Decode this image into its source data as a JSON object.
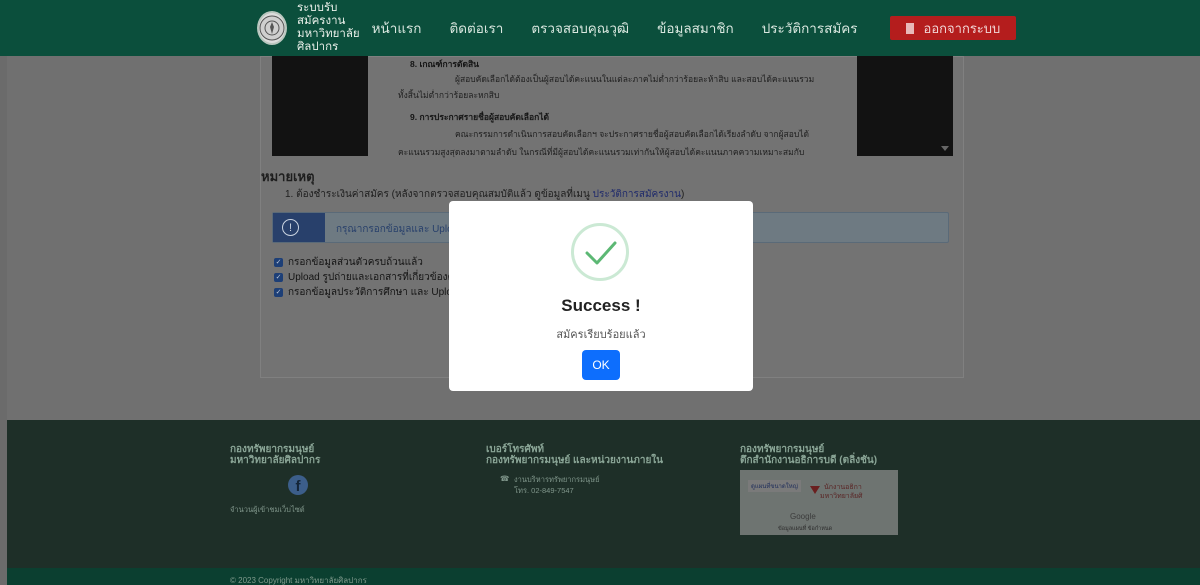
{
  "navbar": {
    "brand_line1": "ระบบรับสมัครงาน",
    "brand_line2": "มหาวิทยาลัยศิลปากร",
    "links": [
      "หน้าแรก",
      "ติดต่อเรา",
      "ตรวจสอบคุณวุฒิ",
      "ข้อมูลสมาชิก",
      "ประวัติการสมัคร"
    ],
    "logout_label": "ออกจากระบบ"
  },
  "document": {
    "line_partial": "8. เกณฑ์การตัดสิน",
    "line1": "ผู้สอบคัดเลือกได้ต้องเป็นผู้สอบได้คะแนนในแต่ละภาคไม่ต่ำกว่าร้อยละห้าสิบ และสอบได้คะแนนรวม",
    "line2": "ทั้งสิ้นไม่ต่ำกว่าร้อยละหกสิบ",
    "section9_title": "9.  การประกาศรายชื่อผู้สอบคัดเลือกได้",
    "line3": "คณะกรรมการดำเนินการสอบคัดเลือกฯ จะประกาศรายชื่อผู้สอบคัดเลือกได้เรียงลำดับ จากผู้สอบได้",
    "line4": "คะแนนรวมสูงสุดลงมาตามลำดับ ในกรณีที่มีผู้สอบได้คะแนนรวมเท่ากันให้ผู้สอบได้คะแนนภาคความเหมาะสมกับ"
  },
  "notes": {
    "title": "หมายเหตุ",
    "item1_text": "1. ต้องชำระเงินค่าสมัคร (หลังจากตรวจสอบคุณสมบัติแล้ว ดูข้อมูลที่เมนู ",
    "item1_link": "ประวัติการสมัครงาน",
    "item1_end": ")"
  },
  "alert": {
    "text": "กรุณากรอกข้อมูลและ Upload เอ"
  },
  "checklist": [
    "กรอกข้อมูลส่วนตัวครบถ้วนแล้ว",
    "Upload รูปถ่ายและเอกสารที่เกี่ยวข้องค",
    "กรอกข้อมูลประวัติการศึกษา และ Uploa"
  ],
  "footer": {
    "col1_title1": "กองทรัพยากรมนุษย์",
    "col1_title2": "มหาวิทยาลัยศิลปากร",
    "visitors_label": "จำนวนผู้เข้าชมเว็บไซต์",
    "col2_title1": "เบอร์โทรศัพท์",
    "col2_title2": "กองทรัพยากรมนุษย์ และหน่วยงานภายใน",
    "phone_dept": "งานบริหารทรัพยากรมนุษย์",
    "phone_number": "โทร. 02-849-7547",
    "col3_title1": "กองทรัพยากรมนุษย์",
    "col3_title2": "ตึกสำนักงานอธิการบดี (ตลิ่งชัน)",
    "map_tag": "ดูแผนที่ขนาดใหญ่",
    "map_label1": "นักงานอธิกา",
    "map_label2": "มหาวิทยาลัยศิ",
    "map_google": "Google",
    "map_footer": "ข้อมูลแผนที่   ข้อกำหนด",
    "copyright": "© 2023 Copyright มหาวิทยาลัยศิลปากร"
  },
  "modal": {
    "title": "Success !",
    "message": "สมัครเรียบร้อยแล้ว",
    "ok_label": "OK"
  },
  "colors": {
    "navbar": "#0b4f3c",
    "logout": "#b41d1d",
    "ok_button": "#0d6efd",
    "success_check": "#5cb874"
  }
}
